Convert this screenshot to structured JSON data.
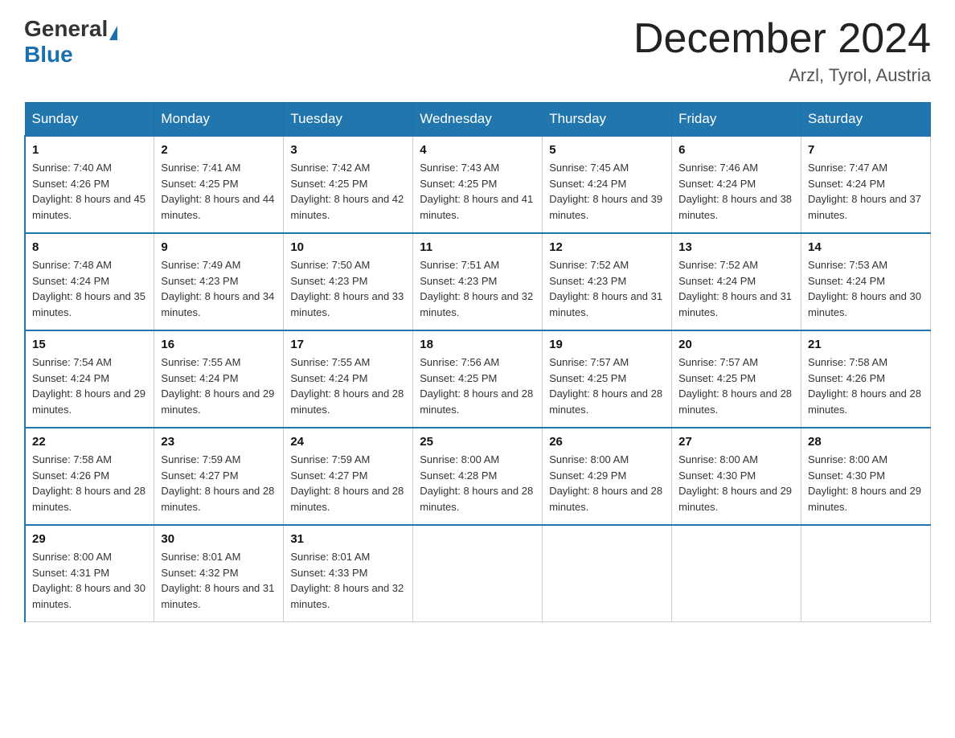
{
  "header": {
    "logo_general": "General",
    "logo_blue": "Blue",
    "title": "December 2024",
    "location": "Arzl, Tyrol, Austria"
  },
  "days_of_week": [
    "Sunday",
    "Monday",
    "Tuesday",
    "Wednesday",
    "Thursday",
    "Friday",
    "Saturday"
  ],
  "weeks": [
    [
      {
        "day": "1",
        "sunrise": "7:40 AM",
        "sunset": "4:26 PM",
        "daylight": "8 hours and 45 minutes."
      },
      {
        "day": "2",
        "sunrise": "7:41 AM",
        "sunset": "4:25 PM",
        "daylight": "8 hours and 44 minutes."
      },
      {
        "day": "3",
        "sunrise": "7:42 AM",
        "sunset": "4:25 PM",
        "daylight": "8 hours and 42 minutes."
      },
      {
        "day": "4",
        "sunrise": "7:43 AM",
        "sunset": "4:25 PM",
        "daylight": "8 hours and 41 minutes."
      },
      {
        "day": "5",
        "sunrise": "7:45 AM",
        "sunset": "4:24 PM",
        "daylight": "8 hours and 39 minutes."
      },
      {
        "day": "6",
        "sunrise": "7:46 AM",
        "sunset": "4:24 PM",
        "daylight": "8 hours and 38 minutes."
      },
      {
        "day": "7",
        "sunrise": "7:47 AM",
        "sunset": "4:24 PM",
        "daylight": "8 hours and 37 minutes."
      }
    ],
    [
      {
        "day": "8",
        "sunrise": "7:48 AM",
        "sunset": "4:24 PM",
        "daylight": "8 hours and 35 minutes."
      },
      {
        "day": "9",
        "sunrise": "7:49 AM",
        "sunset": "4:23 PM",
        "daylight": "8 hours and 34 minutes."
      },
      {
        "day": "10",
        "sunrise": "7:50 AM",
        "sunset": "4:23 PM",
        "daylight": "8 hours and 33 minutes."
      },
      {
        "day": "11",
        "sunrise": "7:51 AM",
        "sunset": "4:23 PM",
        "daylight": "8 hours and 32 minutes."
      },
      {
        "day": "12",
        "sunrise": "7:52 AM",
        "sunset": "4:23 PM",
        "daylight": "8 hours and 31 minutes."
      },
      {
        "day": "13",
        "sunrise": "7:52 AM",
        "sunset": "4:24 PM",
        "daylight": "8 hours and 31 minutes."
      },
      {
        "day": "14",
        "sunrise": "7:53 AM",
        "sunset": "4:24 PM",
        "daylight": "8 hours and 30 minutes."
      }
    ],
    [
      {
        "day": "15",
        "sunrise": "7:54 AM",
        "sunset": "4:24 PM",
        "daylight": "8 hours and 29 minutes."
      },
      {
        "day": "16",
        "sunrise": "7:55 AM",
        "sunset": "4:24 PM",
        "daylight": "8 hours and 29 minutes."
      },
      {
        "day": "17",
        "sunrise": "7:55 AM",
        "sunset": "4:24 PM",
        "daylight": "8 hours and 28 minutes."
      },
      {
        "day": "18",
        "sunrise": "7:56 AM",
        "sunset": "4:25 PM",
        "daylight": "8 hours and 28 minutes."
      },
      {
        "day": "19",
        "sunrise": "7:57 AM",
        "sunset": "4:25 PM",
        "daylight": "8 hours and 28 minutes."
      },
      {
        "day": "20",
        "sunrise": "7:57 AM",
        "sunset": "4:25 PM",
        "daylight": "8 hours and 28 minutes."
      },
      {
        "day": "21",
        "sunrise": "7:58 AM",
        "sunset": "4:26 PM",
        "daylight": "8 hours and 28 minutes."
      }
    ],
    [
      {
        "day": "22",
        "sunrise": "7:58 AM",
        "sunset": "4:26 PM",
        "daylight": "8 hours and 28 minutes."
      },
      {
        "day": "23",
        "sunrise": "7:59 AM",
        "sunset": "4:27 PM",
        "daylight": "8 hours and 28 minutes."
      },
      {
        "day": "24",
        "sunrise": "7:59 AM",
        "sunset": "4:27 PM",
        "daylight": "8 hours and 28 minutes."
      },
      {
        "day": "25",
        "sunrise": "8:00 AM",
        "sunset": "4:28 PM",
        "daylight": "8 hours and 28 minutes."
      },
      {
        "day": "26",
        "sunrise": "8:00 AM",
        "sunset": "4:29 PM",
        "daylight": "8 hours and 28 minutes."
      },
      {
        "day": "27",
        "sunrise": "8:00 AM",
        "sunset": "4:30 PM",
        "daylight": "8 hours and 29 minutes."
      },
      {
        "day": "28",
        "sunrise": "8:00 AM",
        "sunset": "4:30 PM",
        "daylight": "8 hours and 29 minutes."
      }
    ],
    [
      {
        "day": "29",
        "sunrise": "8:00 AM",
        "sunset": "4:31 PM",
        "daylight": "8 hours and 30 minutes."
      },
      {
        "day": "30",
        "sunrise": "8:01 AM",
        "sunset": "4:32 PM",
        "daylight": "8 hours and 31 minutes."
      },
      {
        "day": "31",
        "sunrise": "8:01 AM",
        "sunset": "4:33 PM",
        "daylight": "8 hours and 32 minutes."
      },
      null,
      null,
      null,
      null
    ]
  ]
}
